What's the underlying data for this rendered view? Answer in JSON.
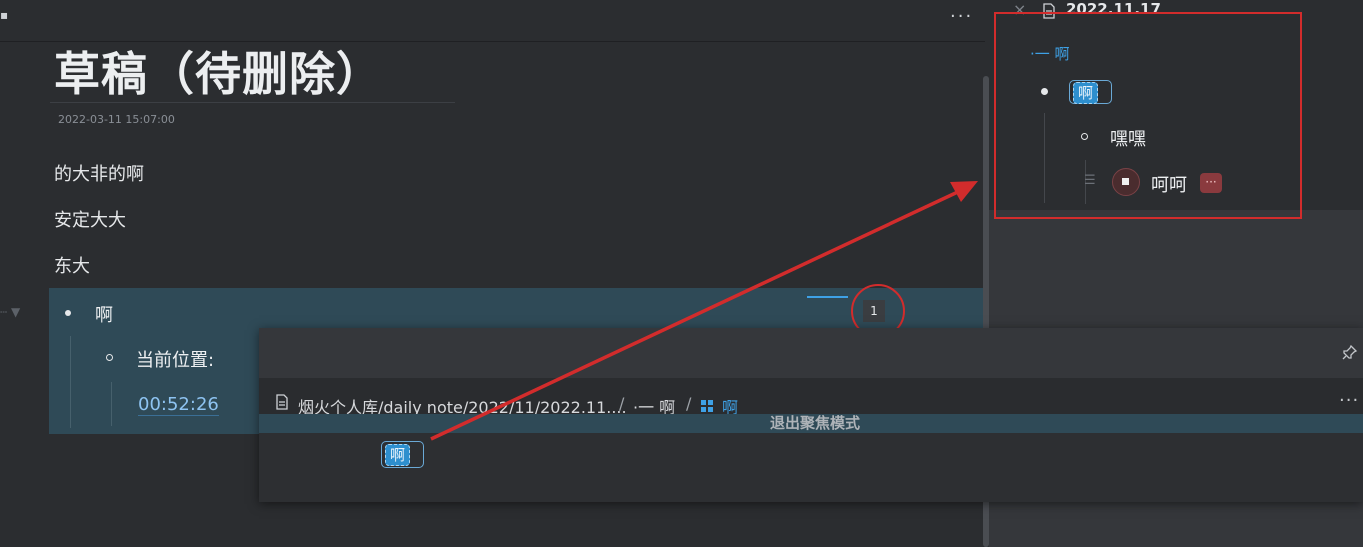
{
  "editor": {
    "more_label": "···",
    "grip_label": "▪",
    "title": "草稿（待删除）",
    "timestamp": "2022-03-11 15:07:00",
    "paragraphs": [
      "的大非的啊",
      "安定大大",
      "东大"
    ],
    "focus_block": {
      "item1": "啊",
      "item2": "当前位置:",
      "time": "00:52:26",
      "ref_count": "1"
    }
  },
  "sidebar": {
    "tab_label": "2022.11.17",
    "close_icon": "×",
    "breadcrumb": "·一 啊",
    "tag": "啊",
    "item2": "嘿嘿",
    "item3": "呵呵",
    "list_icon": "☰",
    "more_badge": "···"
  },
  "popup": {
    "pin_icon": "⊥",
    "breadcrumb_path": "烟火个人库/daily note/2022/11/2022.11....",
    "sep": "/",
    "breadcrumb_mid": "·一 啊",
    "breadcrumb_last": "啊",
    "more_label": "···",
    "exit_label": "退出聚焦模式",
    "tag": "啊"
  },
  "colors": {
    "accent": "#3ea1e6",
    "annotation_red": "#d22c2c",
    "focus_bg": "#2f4a57"
  }
}
